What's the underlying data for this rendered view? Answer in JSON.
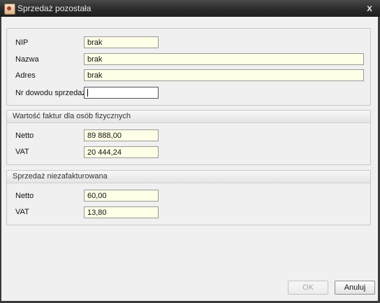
{
  "window": {
    "title": "Sprzedaż pozostała",
    "close_symbol": "x",
    "icon": "app-icon"
  },
  "general": {
    "nip_label": "NIP",
    "nip_value": "brak",
    "name_label": "Nazwa",
    "name_value": "brak",
    "address_label": "Adres",
    "address_value": "brak",
    "receipt_label": "Nr dowodu sprzedaży",
    "receipt_value": ""
  },
  "invoices": {
    "header": "Wartość faktur dla osób fizycznych",
    "net_label": "Netto",
    "net_value": "89 888,00",
    "vat_label": "VAT",
    "vat_value": "20 444,24"
  },
  "uninvoiced": {
    "header": "Sprzedaż niezafakturowana",
    "net_label": "Netto",
    "net_value": "60,00",
    "vat_label": "VAT",
    "vat_value": "13,80"
  },
  "buttons": {
    "ok_label": "OK",
    "cancel_label": "Anuluj"
  }
}
